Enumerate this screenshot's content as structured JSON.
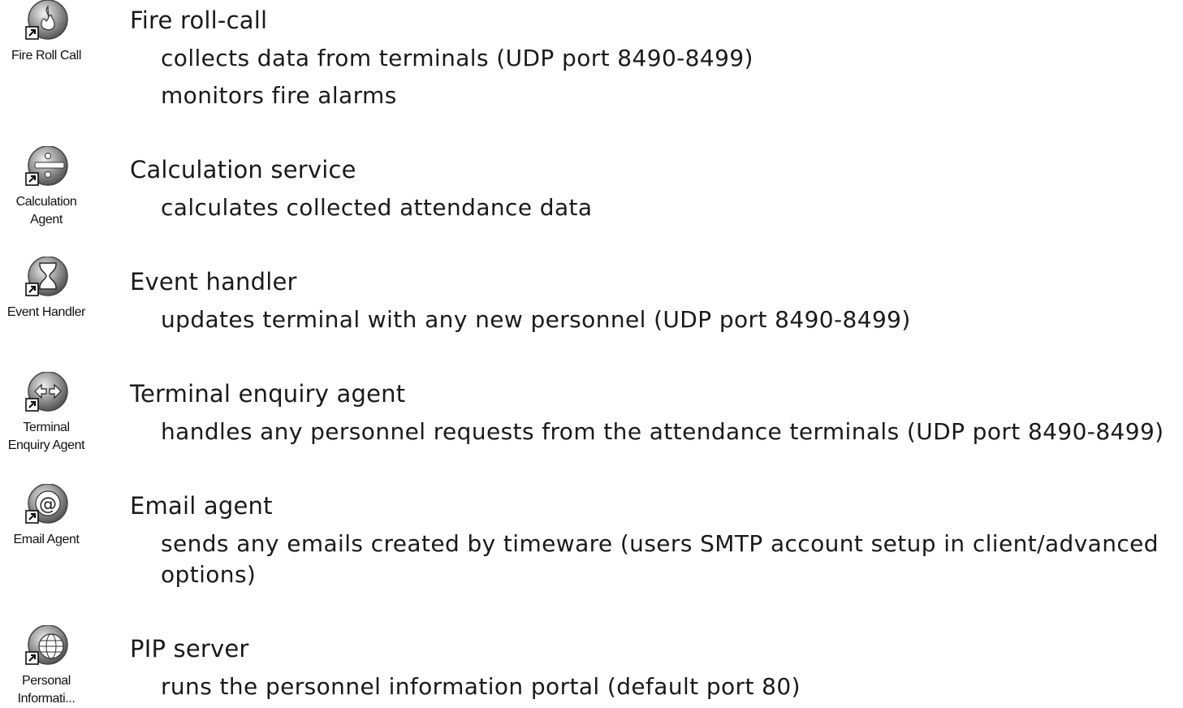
{
  "services": [
    {
      "icon": "fire-icon",
      "shortcut_label": "Fire Roll Call",
      "title": "Fire roll-call",
      "lines": [
        "collects data from terminals (UDP port 8490-8499)",
        "monitors fire alarms"
      ]
    },
    {
      "icon": "calculation-icon",
      "shortcut_label": "Calculation\nAgent",
      "title": "Calculation service",
      "lines": [
        "calculates collected attendance data"
      ]
    },
    {
      "icon": "hourglass-icon",
      "shortcut_label": "Event Handler",
      "title": "Event handler",
      "lines": [
        "updates terminal with any new personnel (UDP port 8490-8499)"
      ]
    },
    {
      "icon": "enquiry-arrows-icon",
      "shortcut_label": "Terminal\nEnquiry Agent",
      "title": "Terminal enquiry agent",
      "lines": [
        "handles any personnel requests from the attendance terminals (UDP port 8490-8499)"
      ]
    },
    {
      "icon": "email-at-icon",
      "shortcut_label": "Email Agent",
      "title": "Email agent",
      "lines": [
        "sends any emails created by timeware (users SMTP account setup in client/advanced options)"
      ]
    },
    {
      "icon": "globe-icon",
      "shortcut_label": "Personal\nInformati...",
      "title": "PIP server",
      "lines": [
        "runs the personnel information portal (default port 80)"
      ]
    }
  ]
}
